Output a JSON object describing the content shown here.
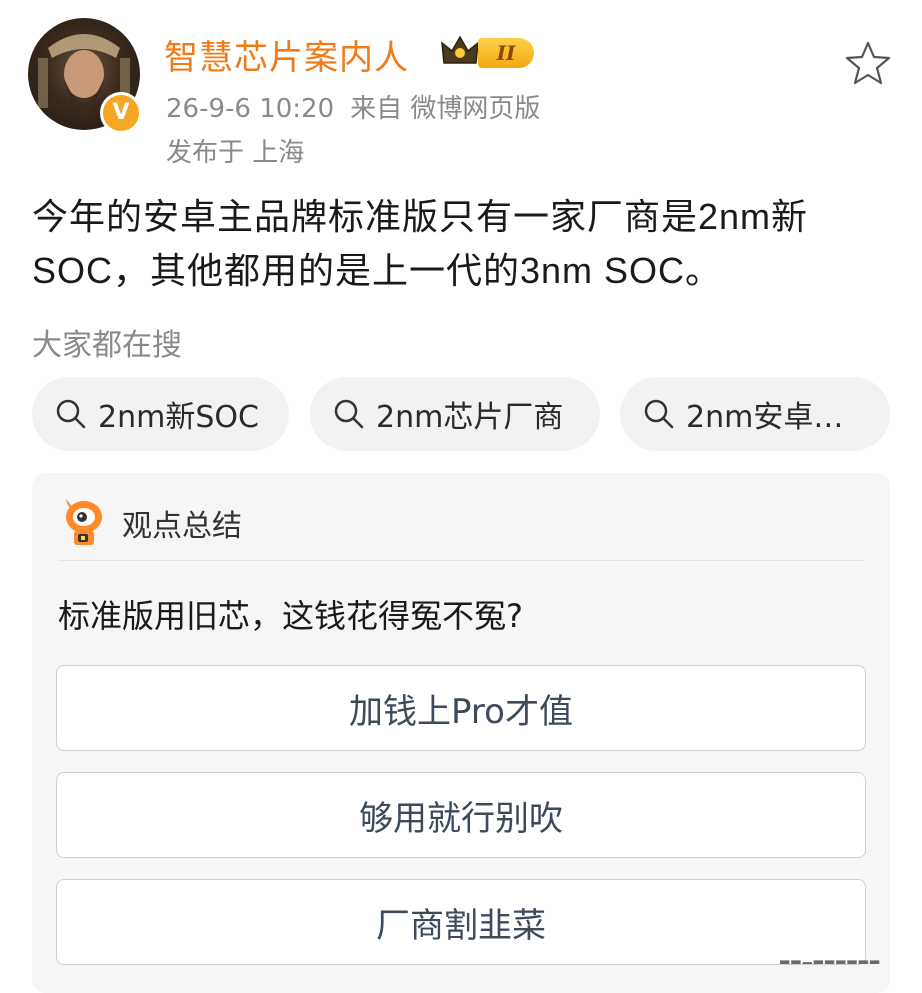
{
  "post": {
    "username": "智慧芯片案内人",
    "level_badge": "II",
    "verified_badge": "V",
    "timestamp": "26-9-6 10:20",
    "source": "来自 微博网页版",
    "location": "发布于 上海",
    "content": "今年的安卓主品牌标准版只有一家厂商是2nm新SOC，其他都用的是上一代的3nm SOC。"
  },
  "search": {
    "title": "大家都在搜",
    "chips": [
      "2nm新SOC",
      "2nm芯片厂商",
      "2nm安卓…"
    ]
  },
  "poll": {
    "card_title": "观点总结",
    "question": "标准版用旧芯，这钱花得冤不冤?",
    "options": [
      "加钱上Pro才值",
      "够用就行别吹",
      "厂商割韭菜"
    ]
  },
  "colors": {
    "username": "#ef7a16",
    "meta": "#8a8a8a",
    "chip_bg": "#f2f2f2",
    "card_bg": "#f6f6f6",
    "option_text": "#3c4a5c",
    "badge": "#f5a623"
  },
  "icons": [
    "star-icon",
    "search-icon",
    "crown-icon",
    "mascot-icon"
  ]
}
